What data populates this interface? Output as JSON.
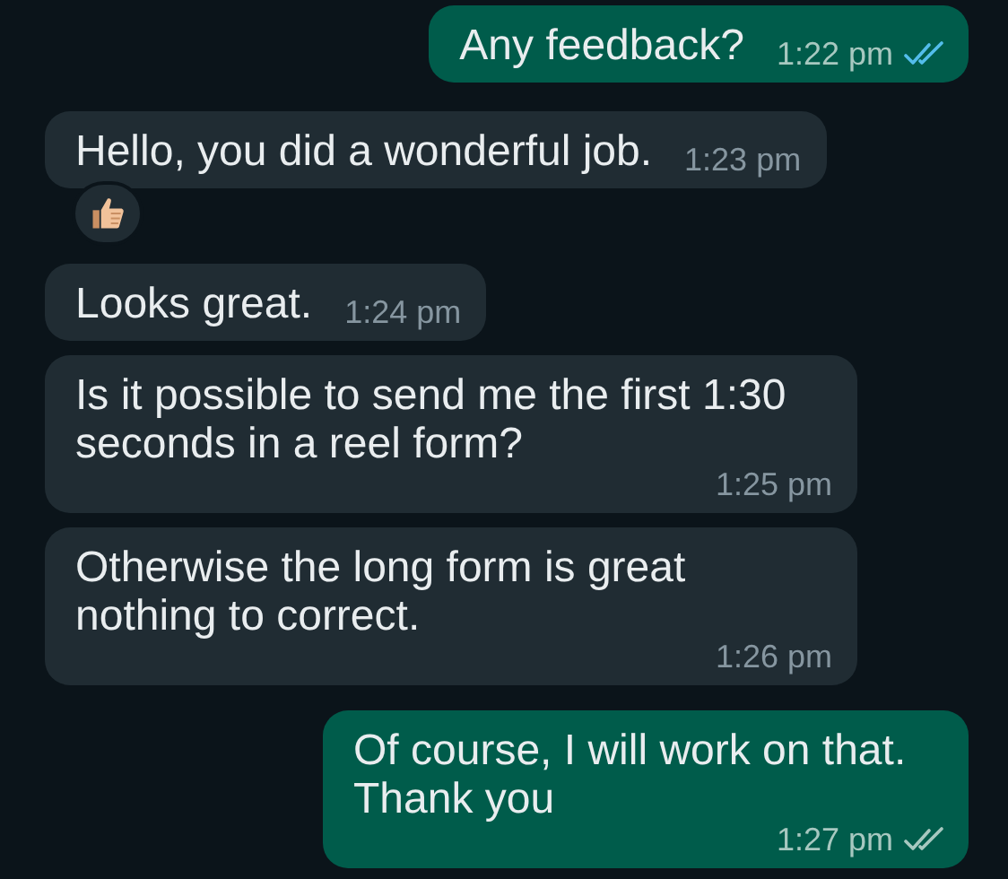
{
  "messages": [
    {
      "outgoing": true,
      "text": "Any feedback?",
      "time": "1:22 pm",
      "read": true
    },
    {
      "outgoing": false,
      "text": "Hello, you did a wonderful job.",
      "time": "1:23 pm",
      "reacted": true
    },
    {
      "outgoing": false,
      "text": "Looks great.",
      "time": "1:24 pm"
    },
    {
      "outgoing": false,
      "text": "Is it possible to send me the first 1:30 seconds in a reel form?",
      "time": "1:25 pm"
    },
    {
      "outgoing": false,
      "text": "Otherwise the long form is great nothing to correct.",
      "time": "1:26 pm"
    },
    {
      "outgoing": true,
      "text": "Of course, I will work on that. Thank you",
      "time": "1:27 pm",
      "read": false
    }
  ]
}
